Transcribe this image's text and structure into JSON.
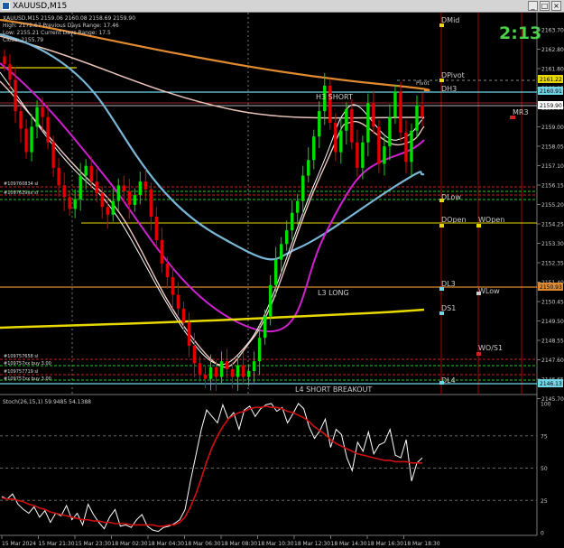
{
  "window": {
    "title": "XAUUSD,M15",
    "min": "_",
    "max": "□",
    "close": "×"
  },
  "info_panel": [
    "XAUUSD,M15  2159.06 2160.08 2158.69 2159.90",
    "High: 2172.67    Previous Days Range: 17.46",
    "Low: 2155.21     Current Days Range: 17.5",
    "Close: 2155.79"
  ],
  "timer": "2:13",
  "colors": {
    "bull": "#00e000",
    "bear": "#e00000",
    "timer": "#4cd04c",
    "cyan": "#6fd6e6",
    "orange": "#e08a30",
    "yellow": "#e6d800",
    "magenta": "#d020d0",
    "skyblue": "#7ab8d8"
  },
  "price_axis": {
    "ticks": [
      "2163.70",
      "2162.80",
      "2161.80",
      "2160.85",
      "2159.90",
      "2159.00",
      "2158.05",
      "2157.10",
      "2156.15",
      "2155.20",
      "2154.25",
      "2153.30",
      "2152.35",
      "2151.40",
      "2150.45",
      "2149.50",
      "2148.55",
      "2147.60",
      "2146.65",
      "2145.70"
    ],
    "badges": [
      {
        "text": "2161.22",
        "color": "#e6d800"
      },
      {
        "text": "2160.91",
        "color": "#6fd6e6"
      },
      {
        "text": "2159.90",
        "color": "#ffffff"
      },
      {
        "text": "2150.93",
        "color": "#e08a30"
      },
      {
        "text": "2146.13",
        "color": "#6fd6e6"
      }
    ]
  },
  "levels": [
    {
      "text": "DMid"
    },
    {
      "text": "DPivot"
    },
    {
      "text": "Pivot"
    },
    {
      "text": "DH3"
    },
    {
      "text": "H3 SHORT"
    },
    {
      "text": "MR3"
    },
    {
      "text": "DLow"
    },
    {
      "text": "DOpen"
    },
    {
      "text": "WOpen"
    },
    {
      "text": "DL3"
    },
    {
      "text": "WLow"
    },
    {
      "text": "L3 LONG"
    },
    {
      "text": "DS1"
    },
    {
      "text": "WO/S1"
    },
    {
      "text": "DL4"
    },
    {
      "text": "L4 SHORT BREAKOUT"
    }
  ],
  "orders": [
    "#109760834 sl",
    "#1097629xx sl",
    "#109757658 sl",
    "#109757xx buy 3.00",
    "#109757719 sl",
    "#109757xx buy 3.00"
  ],
  "oscillator": {
    "label": "Stoch(26,15,1) 59.9485 54.1388",
    "ticks": [
      "100",
      "75",
      "50",
      "25",
      "0"
    ]
  },
  "time_axis": [
    "15 Mar 2024",
    "15 Mar 21:30",
    "15 Mar 23:30",
    "18 Mar 02:30",
    "18 Mar 04:30",
    "18 Mar 06:30",
    "18 Mar 08:30",
    "18 Mar 10:30",
    "18 Mar 12:30",
    "18 Mar 14:30",
    "18 Mar 16:30",
    "18 Mar 18:30"
  ],
  "chart_data": {
    "type": "candlestick",
    "symbol": "XAUUSD",
    "timeframe": "M15",
    "ohlc_last": {
      "open": 2159.06,
      "high": 2160.08,
      "low": 2158.69,
      "close": 2159.9
    },
    "ylim": [
      2145.7,
      2164.5
    ],
    "closes": [
      2162.6,
      2161.8,
      2160.2,
      2159.3,
      2158.1,
      2159.4,
      2160.4,
      2159.9,
      2158.6,
      2157.3,
      2156.4,
      2155.8,
      2155.2,
      2155.7,
      2156.9,
      2157.4,
      2156.6,
      2156.0,
      2155.3,
      2154.9,
      2155.6,
      2156.4,
      2156.1,
      2155.4,
      2155.9,
      2156.6,
      2156.2,
      2154.8,
      2153.6,
      2152.4,
      2151.7,
      2150.8,
      2150.1,
      2149.4,
      2148.2,
      2147.3,
      2146.7,
      2146.5,
      2147.1,
      2146.6,
      2147.4,
      2147.0,
      2146.6,
      2147.2,
      2146.6,
      2146.9,
      2147.4,
      2148.6,
      2149.7,
      2151.3,
      2152.6,
      2153.4,
      2154.1,
      2155.0,
      2155.6,
      2156.9,
      2157.7,
      2158.9,
      2160.2,
      2161.5,
      2159.6,
      2158.1,
      2159.2,
      2160.3,
      2158.6,
      2157.3,
      2158.6,
      2160.6,
      2159.4,
      2157.5,
      2158.4,
      2159.9,
      2161.2,
      2159.1,
      2157.6,
      2159.2,
      2160.5,
      2159.9
    ],
    "stoch_k": [
      28,
      26,
      30,
      22,
      18,
      15,
      20,
      12,
      17,
      8,
      15,
      13,
      21,
      10,
      15,
      6,
      22,
      14,
      8,
      3,
      12,
      18,
      5,
      6,
      4,
      10,
      14,
      5,
      2,
      1,
      4,
      5,
      7,
      10,
      18,
      40,
      60,
      80,
      95,
      90,
      85,
      99,
      88,
      93,
      80,
      95,
      98,
      90,
      96,
      99,
      100,
      94,
      97,
      85,
      92,
      100,
      96,
      82,
      73,
      79,
      88,
      66,
      80,
      76,
      58,
      48,
      70,
      63,
      78,
      61,
      68,
      70,
      80,
      60,
      58,
      72,
      40,
      54,
      58
    ],
    "stoch_d": [
      27,
      26,
      26,
      25,
      24,
      22,
      21,
      19,
      18,
      16,
      15,
      14,
      13,
      12,
      11,
      10,
      10,
      9,
      9,
      8,
      8,
      7,
      7,
      7,
      6,
      6,
      6,
      6,
      6,
      5,
      5,
      6,
      6,
      8,
      12,
      20,
      30,
      42,
      55,
      66,
      75,
      82,
      88,
      91,
      93,
      94,
      96,
      97,
      97,
      98,
      97,
      97,
      96,
      94,
      93,
      91,
      89,
      86,
      82,
      79,
      76,
      72,
      69,
      67,
      65,
      63,
      61,
      60,
      59,
      58,
      57,
      56,
      56,
      55,
      55,
      55,
      54,
      54,
      54
    ]
  }
}
